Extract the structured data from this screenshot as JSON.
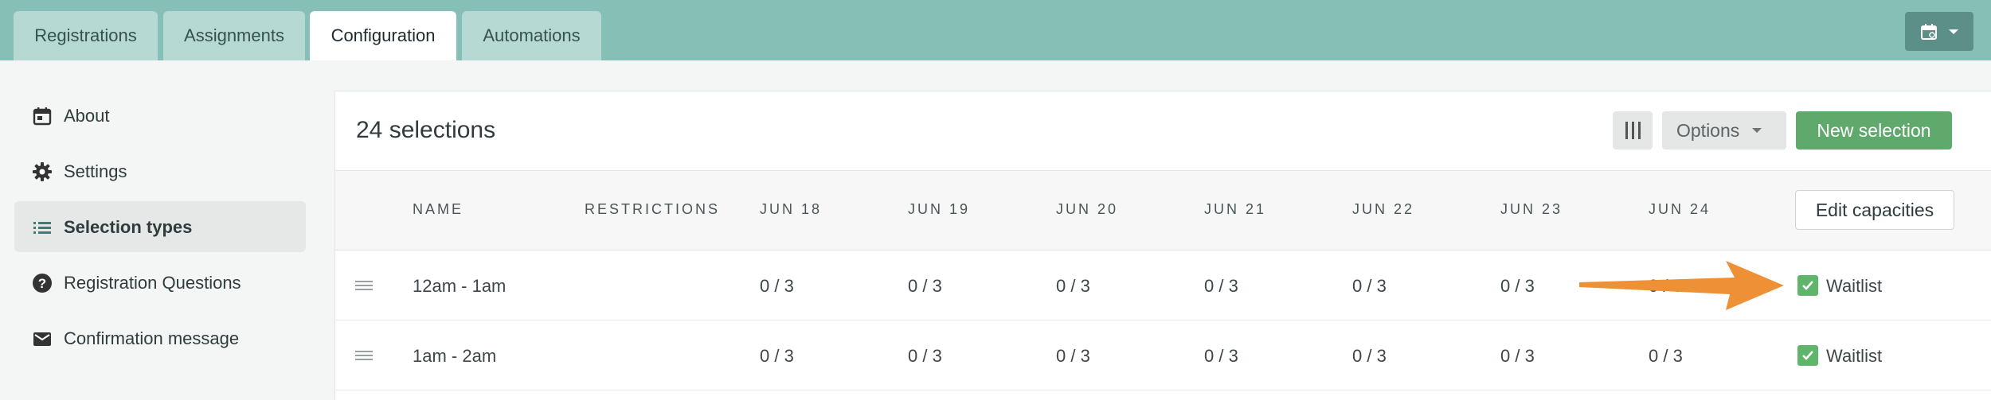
{
  "tabs": [
    {
      "label": "Registrations",
      "active": false
    },
    {
      "label": "Assignments",
      "active": false
    },
    {
      "label": "Configuration",
      "active": true
    },
    {
      "label": "Automations",
      "active": false
    }
  ],
  "header": {
    "calendar_icon": "calendar-icon"
  },
  "sidebar": {
    "items": [
      {
        "label": "About",
        "icon": "calendar-icon"
      },
      {
        "label": "Settings",
        "icon": "gear-icon"
      },
      {
        "label": "Selection types",
        "icon": "list-icon",
        "active": true
      },
      {
        "label": "Registration Questions",
        "icon": "question-icon"
      },
      {
        "label": "Confirmation message",
        "icon": "envelope-icon"
      }
    ]
  },
  "main": {
    "count": "24 selections",
    "options_label": "Options",
    "new_label": "New selection",
    "edit_capacities_label": "Edit capacities",
    "columns": [
      "Name",
      "Restrictions",
      "Jun 18",
      "Jun 19",
      "Jun 20",
      "Jun 21",
      "Jun 22",
      "Jun 23",
      "Jun 24"
    ],
    "rows": [
      {
        "name": "12am - 1am",
        "restrictions": "",
        "cells": [
          "0 / 3",
          "0 / 3",
          "0 / 3",
          "0 / 3",
          "0 / 3",
          "0 / 3",
          "0 / 3"
        ],
        "waitlist_label": "Waitlist",
        "waitlist": true
      },
      {
        "name": "1am - 2am",
        "restrictions": "",
        "cells": [
          "0 / 3",
          "0 / 3",
          "0 / 3",
          "0 / 3",
          "0 / 3",
          "0 / 3",
          "0 / 3"
        ],
        "waitlist_label": "Waitlist",
        "waitlist": true
      }
    ]
  },
  "colors": {
    "topbar": "#86bfb6",
    "accent_green": "#5fa96c",
    "annotation_arrow": "#ee9035"
  }
}
